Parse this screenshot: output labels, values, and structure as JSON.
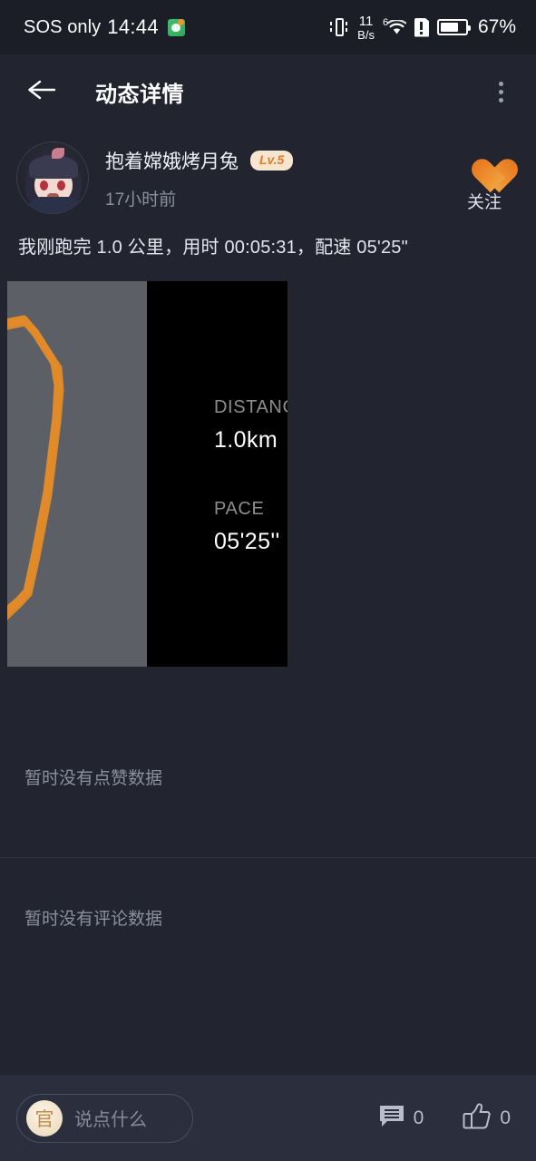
{
  "statusbar": {
    "carrier": "SOS only",
    "time": "14:44",
    "app_icon": "wechat-like-app-icon",
    "vibrate_icon": "vibrate-icon",
    "net_speed_value": "11",
    "net_speed_unit": "B/s",
    "wifi_gen": "6",
    "wifi_icon": "wifi-icon",
    "sim_icon": "sim-alert-icon",
    "battery_icon": "battery-icon",
    "battery_percent": "67%"
  },
  "header": {
    "back_icon": "back-arrow-icon",
    "title": "动态详情",
    "more_icon": "more-vertical-icon"
  },
  "post": {
    "author_name": "抱着嫦娥烤月兔",
    "level_badge": "Lv.5",
    "timestamp": "17小时前",
    "follow_icon": "heart-icon",
    "follow_label": "关注",
    "text": "我刚跑完 1.0 公里，用时 00:05:31，配速 05'25\"",
    "media": {
      "map_route_color": "#e08a29",
      "map_background": "#5c6066",
      "stats_background": "#000000",
      "stats": [
        {
          "label": "DISTANCE",
          "value": "1.0km"
        },
        {
          "label": "PACE",
          "value": "05'25''"
        }
      ]
    }
  },
  "likes_section": {
    "empty_text": "暂时没有点赞数据"
  },
  "comments_section": {
    "empty_text": "暂时没有评论数据"
  },
  "bottom_bar": {
    "avatar_char": "官",
    "input_placeholder": "说点什么",
    "comment_icon": "comment-icon",
    "comment_count": "0",
    "like_icon": "thumbs-up-icon",
    "like_count": "0"
  },
  "colors": {
    "page_background": "#22242f",
    "statusbar_background": "#1b1d27",
    "bottombar_background": "#2b2e3c",
    "accent_orange": "#e8761f",
    "muted_text": "#8b90a0",
    "badge_background": "#f6e5cf",
    "badge_text": "#e07b2a"
  }
}
